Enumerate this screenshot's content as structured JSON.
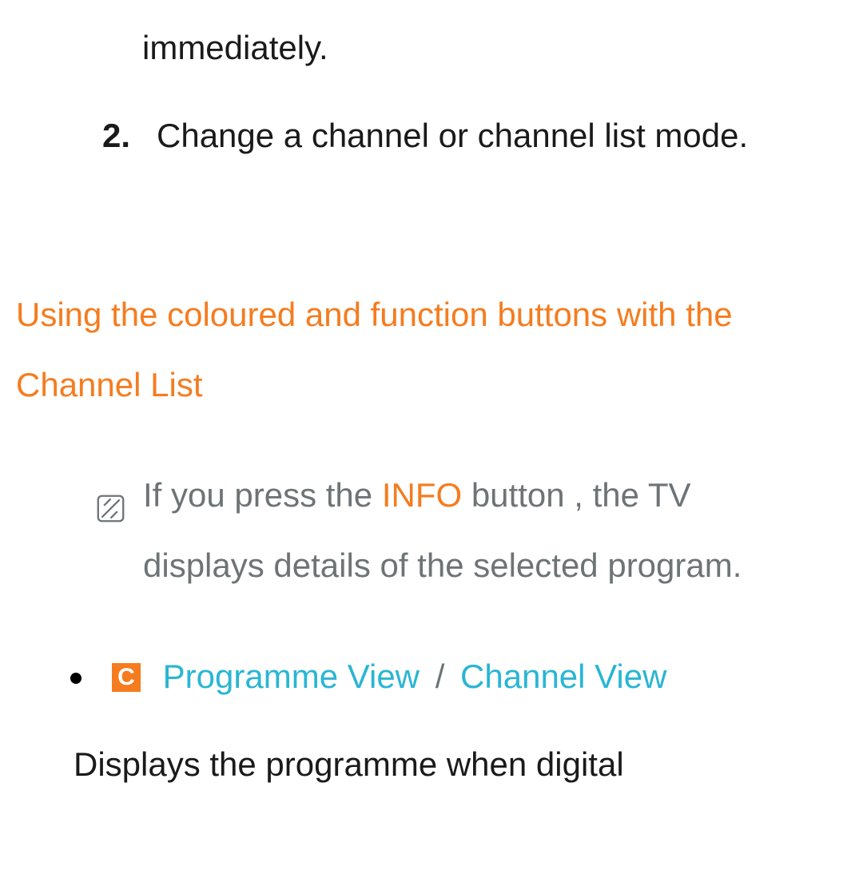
{
  "top_fragment": "immediately.",
  "step2": {
    "number": "2.",
    "text": "Change a channel or channel list mode."
  },
  "section_title": "Using the coloured and function buttons with the Channel List",
  "note": {
    "part1": "If you press the ",
    "info": "INFO",
    "part2": " button , the TV displays details of the selected program."
  },
  "bullet1": {
    "badge": "C",
    "link1": "Programme View",
    "slash": "/",
    "link2": "Channel View"
  },
  "body_text": "Displays the programme when digital"
}
